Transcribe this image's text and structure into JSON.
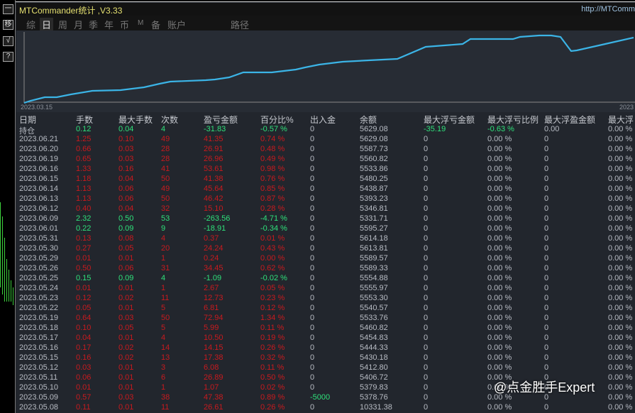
{
  "window": {
    "title": "MTCommander统计 ,V3.33",
    "url": "http://MTComm"
  },
  "left_buttons": [
    "一",
    "移",
    "√",
    "?"
  ],
  "tabs": [
    {
      "label": "综"
    },
    {
      "label": "日",
      "active": true
    },
    {
      "label": "周"
    },
    {
      "label": "月"
    },
    {
      "label": "季"
    },
    {
      "label": "年"
    },
    {
      "label": "币"
    },
    {
      "label": "M"
    },
    {
      "label": "备"
    },
    {
      "label": "账户"
    },
    {
      "label": "路径"
    }
  ],
  "chart": {
    "x_start": "2023.03.15",
    "x_end": "2023",
    "color": "#3bb4e6"
  },
  "columns": [
    "日期",
    "手数",
    "最大手数",
    "次数",
    "盈亏金额",
    "百分比%",
    "出入金",
    "余额",
    "最大浮亏金额",
    "最大浮亏比例",
    "最大浮盈金额",
    "最大浮"
  ],
  "rows": [
    [
      "持仓",
      "0.12",
      "0.04",
      "4",
      "-31.83",
      "-0.57 %",
      "0",
      "5629.08",
      "-35.19",
      "-0.63 %",
      "0.00",
      "0.00 %"
    ],
    [
      "2023.06.21",
      "1.25",
      "0.10",
      "49",
      "41.35",
      "0.74 %",
      "0",
      "5629.08",
      "0",
      "0.00 %",
      "0",
      "0.00 %"
    ],
    [
      "2023.06.20",
      "0.66",
      "0.03",
      "28",
      "26.91",
      "0.48 %",
      "0",
      "5587.73",
      "0",
      "0.00 %",
      "0",
      "0.00 %"
    ],
    [
      "2023.06.19",
      "0.65",
      "0.03",
      "28",
      "26.96",
      "0.49 %",
      "0",
      "5560.82",
      "0",
      "0.00 %",
      "0",
      "0.00 %"
    ],
    [
      "2023.06.16",
      "1.33",
      "0.16",
      "41",
      "53.61",
      "0.98 %",
      "0",
      "5533.86",
      "0",
      "0.00 %",
      "0",
      "0.00 %"
    ],
    [
      "2023.06.15",
      "1.18",
      "0.04",
      "50",
      "41.38",
      "0.76 %",
      "0",
      "5480.25",
      "0",
      "0.00 %",
      "0",
      "0.00 %"
    ],
    [
      "2023.06.14",
      "1.13",
      "0.06",
      "49",
      "45.64",
      "0.85 %",
      "0",
      "5438.87",
      "0",
      "0.00 %",
      "0",
      "0.00 %"
    ],
    [
      "2023.06.13",
      "1.13",
      "0.06",
      "50",
      "46.42",
      "0.87 %",
      "0",
      "5393.23",
      "0",
      "0.00 %",
      "0",
      "0.00 %"
    ],
    [
      "2023.06.12",
      "0.40",
      "0.04",
      "32",
      "15.10",
      "0.28 %",
      "0",
      "5346.81",
      "0",
      "0.00 %",
      "0",
      "0.00 %"
    ],
    [
      "2023.06.09",
      "2.32",
      "0.50",
      "53",
      "-263.56",
      "-4.71 %",
      "0",
      "5331.71",
      "0",
      "0.00 %",
      "0",
      "0.00 %"
    ],
    [
      "2023.06.01",
      "0.22",
      "0.09",
      "9",
      "-18.91",
      "-0.34 %",
      "0",
      "5595.27",
      "0",
      "0.00 %",
      "0",
      "0.00 %"
    ],
    [
      "2023.05.31",
      "0.13",
      "0.08",
      "4",
      "0.37",
      "0.01 %",
      "0",
      "5614.18",
      "0",
      "0.00 %",
      "0",
      "0.00 %"
    ],
    [
      "2023.05.30",
      "0.27",
      "0.05",
      "20",
      "24.24",
      "0.43 %",
      "0",
      "5613.81",
      "0",
      "0.00 %",
      "0",
      "0.00 %"
    ],
    [
      "2023.05.29",
      "0.01",
      "0.01",
      "1",
      "0.24",
      "0.00 %",
      "0",
      "5589.57",
      "0",
      "0.00 %",
      "0",
      "0.00 %"
    ],
    [
      "2023.05.26",
      "0.50",
      "0.06",
      "31",
      "34.45",
      "0.62 %",
      "0",
      "5589.33",
      "0",
      "0.00 %",
      "0",
      "0.00 %"
    ],
    [
      "2023.05.25",
      "0.15",
      "0.09",
      "4",
      "-1.09",
      "-0.02 %",
      "0",
      "5554.88",
      "0",
      "0.00 %",
      "0",
      "0.00 %"
    ],
    [
      "2023.05.24",
      "0.01",
      "0.01",
      "1",
      "2.67",
      "0.05 %",
      "0",
      "5555.97",
      "0",
      "0.00 %",
      "0",
      "0.00 %"
    ],
    [
      "2023.05.23",
      "0.12",
      "0.02",
      "11",
      "12.73",
      "0.23 %",
      "0",
      "5553.30",
      "0",
      "0.00 %",
      "0",
      "0.00 %"
    ],
    [
      "2023.05.22",
      "0.05",
      "0.01",
      "5",
      "6.81",
      "0.12 %",
      "0",
      "5540.57",
      "0",
      "0.00 %",
      "0",
      "0.00 %"
    ],
    [
      "2023.05.19",
      "0.64",
      "0.03",
      "50",
      "72.94",
      "1.34 %",
      "0",
      "5533.76",
      "0",
      "0.00 %",
      "0",
      "0.00 %"
    ],
    [
      "2023.05.18",
      "0.10",
      "0.05",
      "5",
      "5.99",
      "0.11 %",
      "0",
      "5460.82",
      "0",
      "0.00 %",
      "0",
      "0.00 %"
    ],
    [
      "2023.05.17",
      "0.04",
      "0.01",
      "4",
      "10.50",
      "0.19 %",
      "0",
      "5454.83",
      "0",
      "0.00 %",
      "0",
      "0.00 %"
    ],
    [
      "2023.05.16",
      "0.17",
      "0.02",
      "14",
      "14.15",
      "0.26 %",
      "0",
      "5444.33",
      "0",
      "0.00 %",
      "0",
      "0.00 %"
    ],
    [
      "2023.05.15",
      "0.16",
      "0.02",
      "13",
      "17.38",
      "0.32 %",
      "0",
      "5430.18",
      "0",
      "0.00 %",
      "0",
      "0.00 %"
    ],
    [
      "2023.05.12",
      "0.03",
      "0.01",
      "3",
      "6.08",
      "0.11 %",
      "0",
      "5412.80",
      "0",
      "0.00 %",
      "0",
      "0.00 %"
    ],
    [
      "2023.05.11",
      "0.06",
      "0.01",
      "6",
      "26.89",
      "0.50 %",
      "0",
      "5406.72",
      "0",
      "0.00 %",
      "0",
      "0.00 %"
    ],
    [
      "2023.05.10",
      "0.01",
      "0.01",
      "1",
      "1.07",
      "0.02 %",
      "0",
      "5379.83",
      "0",
      "0.00 %",
      "0",
      "0.00 %"
    ],
    [
      "2023.05.09",
      "0.57",
      "0.03",
      "38",
      "47.38",
      "0.89 %",
      "-5000",
      "5378.76",
      "0",
      "0.00 %",
      "0",
      "0.00 %"
    ],
    [
      "2023.05.08",
      "0.11",
      "0.01",
      "11",
      "26.61",
      "0.26 %",
      "0",
      "10331.38",
      "0",
      "0.00 %",
      "0",
      "0.00 %"
    ]
  ],
  "watermark": "@点金胜手Expert"
}
